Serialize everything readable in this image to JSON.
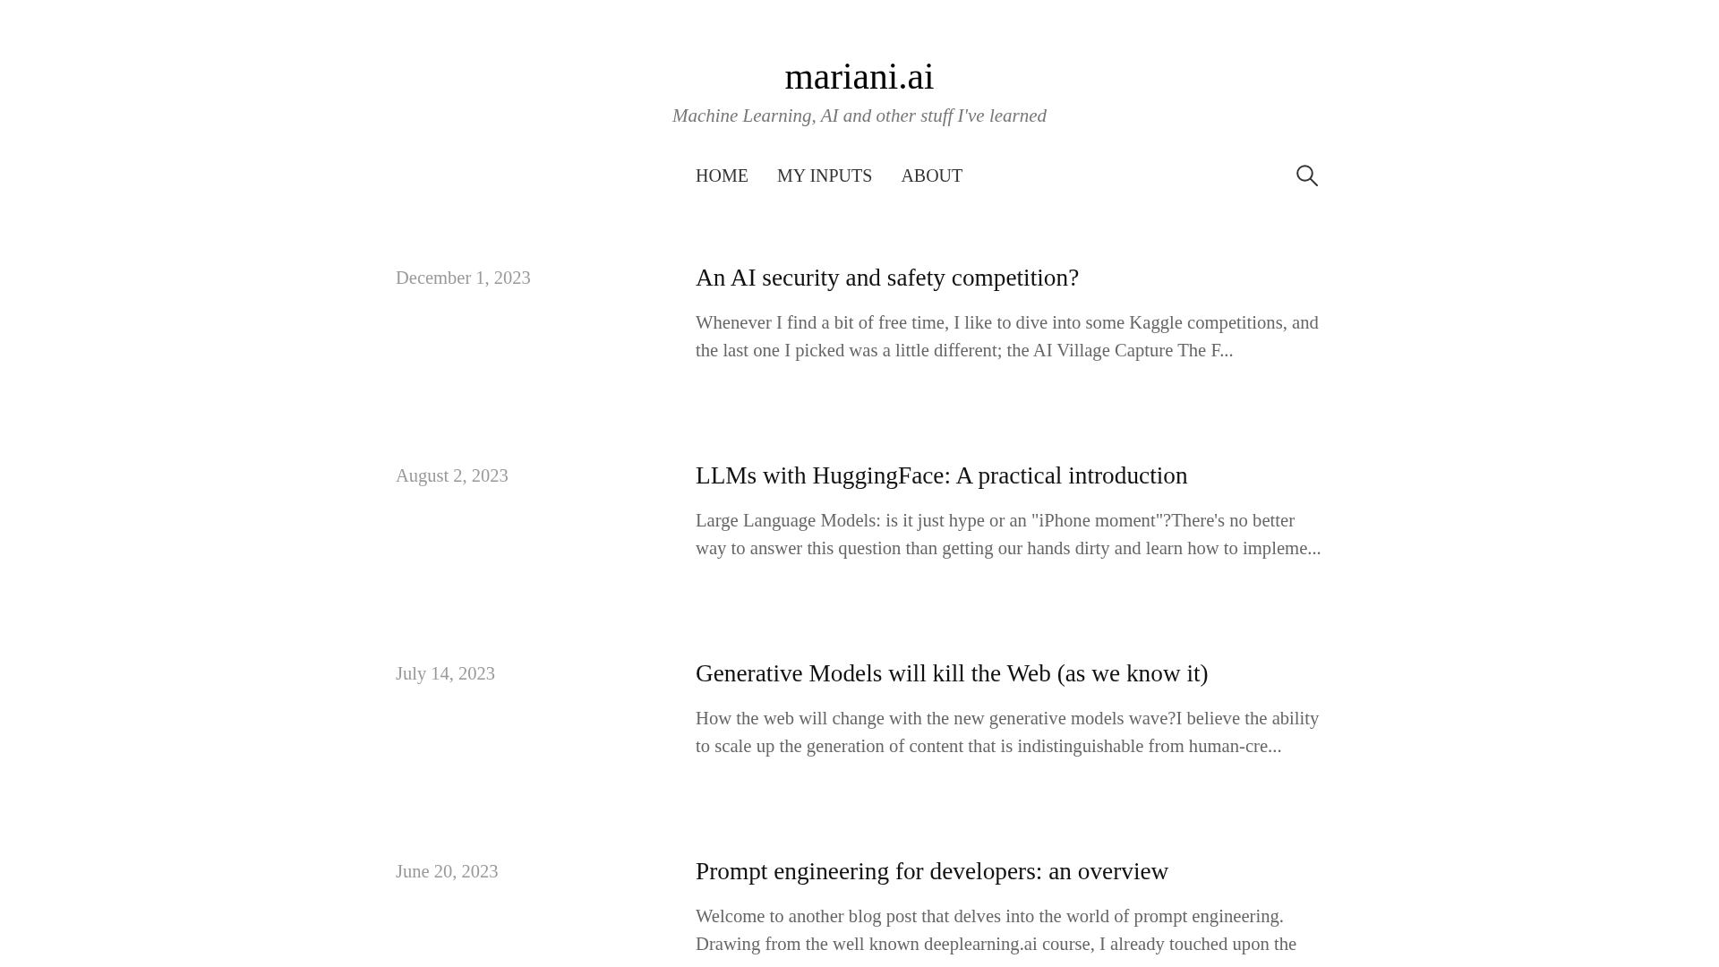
{
  "site": {
    "title": "mariani.ai",
    "tagline": "Machine Learning, AI and other stuff I've learned"
  },
  "nav": {
    "items": [
      {
        "label": "HOME"
      },
      {
        "label": "MY INPUTS"
      },
      {
        "label": "ABOUT"
      }
    ]
  },
  "posts": [
    {
      "date": "December 1, 2023",
      "title": "An AI security and safety competition?",
      "excerpt": "Whenever I find a bit of free time, I like to dive into some Kaggle competitions, and the last one I picked was a little different; the AI Village Capture The F..."
    },
    {
      "date": "August 2, 2023",
      "title": "LLMs with HuggingFace: A practical introduction",
      "excerpt": "Large Language Models: is it just hype or an \"iPhone moment\"?There's no better way to answer this question than getting our hands dirty and learn how to impleme..."
    },
    {
      "date": "July 14, 2023",
      "title": "Generative Models will kill the Web (as we know it)",
      "excerpt": "How the web will change with the new generative models wave?I believe the ability to scale up the generation of content that is indistinguishable from human-cre..."
    },
    {
      "date": "June 20, 2023",
      "title": "Prompt engineering for developers: an overview",
      "excerpt": "Welcome to another blog post that delves into the world of prompt engineering. Drawing from the well known deeplearning.ai course, I already touched upon the"
    }
  ]
}
